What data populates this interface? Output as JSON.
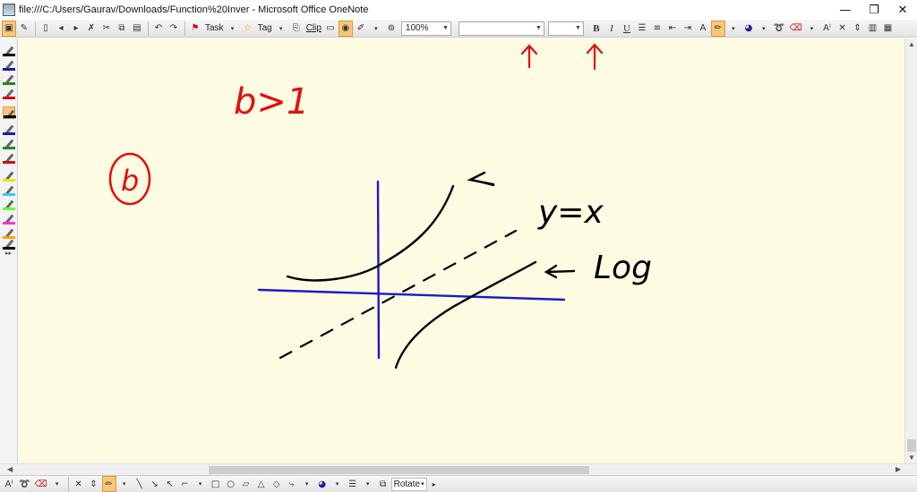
{
  "window": {
    "title": "file:///C:/Users/Gaurav/Downloads/Function%20Inver - Microsoft Office OneNote",
    "controls": {
      "minimize": "—",
      "restore": "❐",
      "close": "✕"
    }
  },
  "toolbar": {
    "task_label": "Task",
    "tag_label": "Tag",
    "clip_label": "Clip",
    "zoom_value": "100%",
    "font_name_value": "",
    "font_size_value": "",
    "bold_label": "B",
    "italic_label": "I",
    "underline_label": "U"
  },
  "pen_palette": {
    "pens": [
      {
        "color": "#000000"
      },
      {
        "color": "#1a1aa6"
      },
      {
        "color": "#1e8a1e"
      },
      {
        "color": "#d01010"
      },
      {
        "color": "#000000",
        "selected": true
      },
      {
        "color": "#1a1aa6"
      },
      {
        "color": "#1e8a1e"
      },
      {
        "color": "#d01010"
      },
      {
        "color": "#e6e600"
      },
      {
        "color": "#33ccff"
      },
      {
        "color": "#66ff33"
      },
      {
        "color": "#ff33cc"
      },
      {
        "color": "#ffa500"
      },
      {
        "color": "#000000"
      }
    ]
  },
  "canvas": {
    "background": "#fefbe3",
    "ink_text": {
      "condition": "b>1",
      "part_label": "b",
      "line_label": "y=x",
      "log_label": "Log"
    },
    "ink_colors": {
      "red": "#e01010",
      "black": "#000000",
      "blue": "#1a1ac8"
    }
  },
  "drawbar": {
    "rotate_label": "Rotate"
  }
}
